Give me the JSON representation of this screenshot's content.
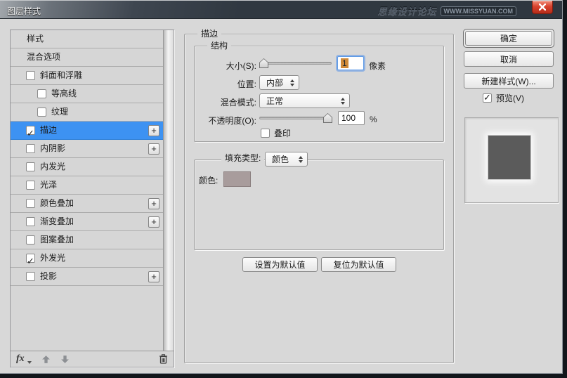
{
  "colors": {
    "accent_blue": "#3d92f2",
    "swatch": "#a89c9c",
    "preview_square": "#5b5b5b",
    "close_red": "#d8422e"
  },
  "window": {
    "title": "图层样式",
    "watermark_brand": "思缘设计论坛",
    "watermark_url": "WWW.MISSYUAN.COM"
  },
  "sidebar": {
    "items": [
      {
        "label": "样式",
        "checkbox": false,
        "checked": false,
        "indent": 0,
        "plus": false,
        "selected": false
      },
      {
        "label": "混合选项",
        "checkbox": false,
        "checked": false,
        "indent": 0,
        "plus": false,
        "selected": false
      },
      {
        "label": "斜面和浮雕",
        "checkbox": true,
        "checked": false,
        "indent": 0,
        "plus": false,
        "selected": false
      },
      {
        "label": "等高线",
        "checkbox": true,
        "checked": false,
        "indent": 1,
        "plus": false,
        "selected": false
      },
      {
        "label": "纹理",
        "checkbox": true,
        "checked": false,
        "indent": 1,
        "plus": false,
        "selected": false
      },
      {
        "label": "描边",
        "checkbox": true,
        "checked": true,
        "indent": 0,
        "plus": true,
        "selected": true
      },
      {
        "label": "内阴影",
        "checkbox": true,
        "checked": false,
        "indent": 0,
        "plus": true,
        "selected": false
      },
      {
        "label": "内发光",
        "checkbox": true,
        "checked": false,
        "indent": 0,
        "plus": false,
        "selected": false
      },
      {
        "label": "光泽",
        "checkbox": true,
        "checked": false,
        "indent": 0,
        "plus": false,
        "selected": false
      },
      {
        "label": "颜色叠加",
        "checkbox": true,
        "checked": false,
        "indent": 0,
        "plus": true,
        "selected": false
      },
      {
        "label": "渐变叠加",
        "checkbox": true,
        "checked": false,
        "indent": 0,
        "plus": true,
        "selected": false
      },
      {
        "label": "图案叠加",
        "checkbox": true,
        "checked": false,
        "indent": 0,
        "plus": false,
        "selected": false
      },
      {
        "label": "外发光",
        "checkbox": true,
        "checked": true,
        "indent": 0,
        "plus": false,
        "selected": false
      },
      {
        "label": "投影",
        "checkbox": true,
        "checked": false,
        "indent": 0,
        "plus": true,
        "selected": false
      }
    ],
    "footer": {
      "fx": "fx"
    }
  },
  "panel": {
    "title": "描边",
    "structure": {
      "title": "结构",
      "size_label": "大小(S):",
      "size_value": "1",
      "size_unit": "像素",
      "position_label": "位置:",
      "position_value": "内部",
      "blend_label": "混合模式:",
      "blend_value": "正常",
      "opacity_label": "不透明度(O):",
      "opacity_value": "100",
      "opacity_unit": "%",
      "overprint_label": "叠印"
    },
    "fill": {
      "type_label": "填充类型:",
      "type_value": "颜色",
      "color_label": "颜色:"
    },
    "defaults": {
      "set": "设置为默认值",
      "reset": "复位为默认值"
    }
  },
  "actions": {
    "ok": "确定",
    "cancel": "取消",
    "new_style": "新建样式(W)...",
    "preview": "预览(V)"
  }
}
